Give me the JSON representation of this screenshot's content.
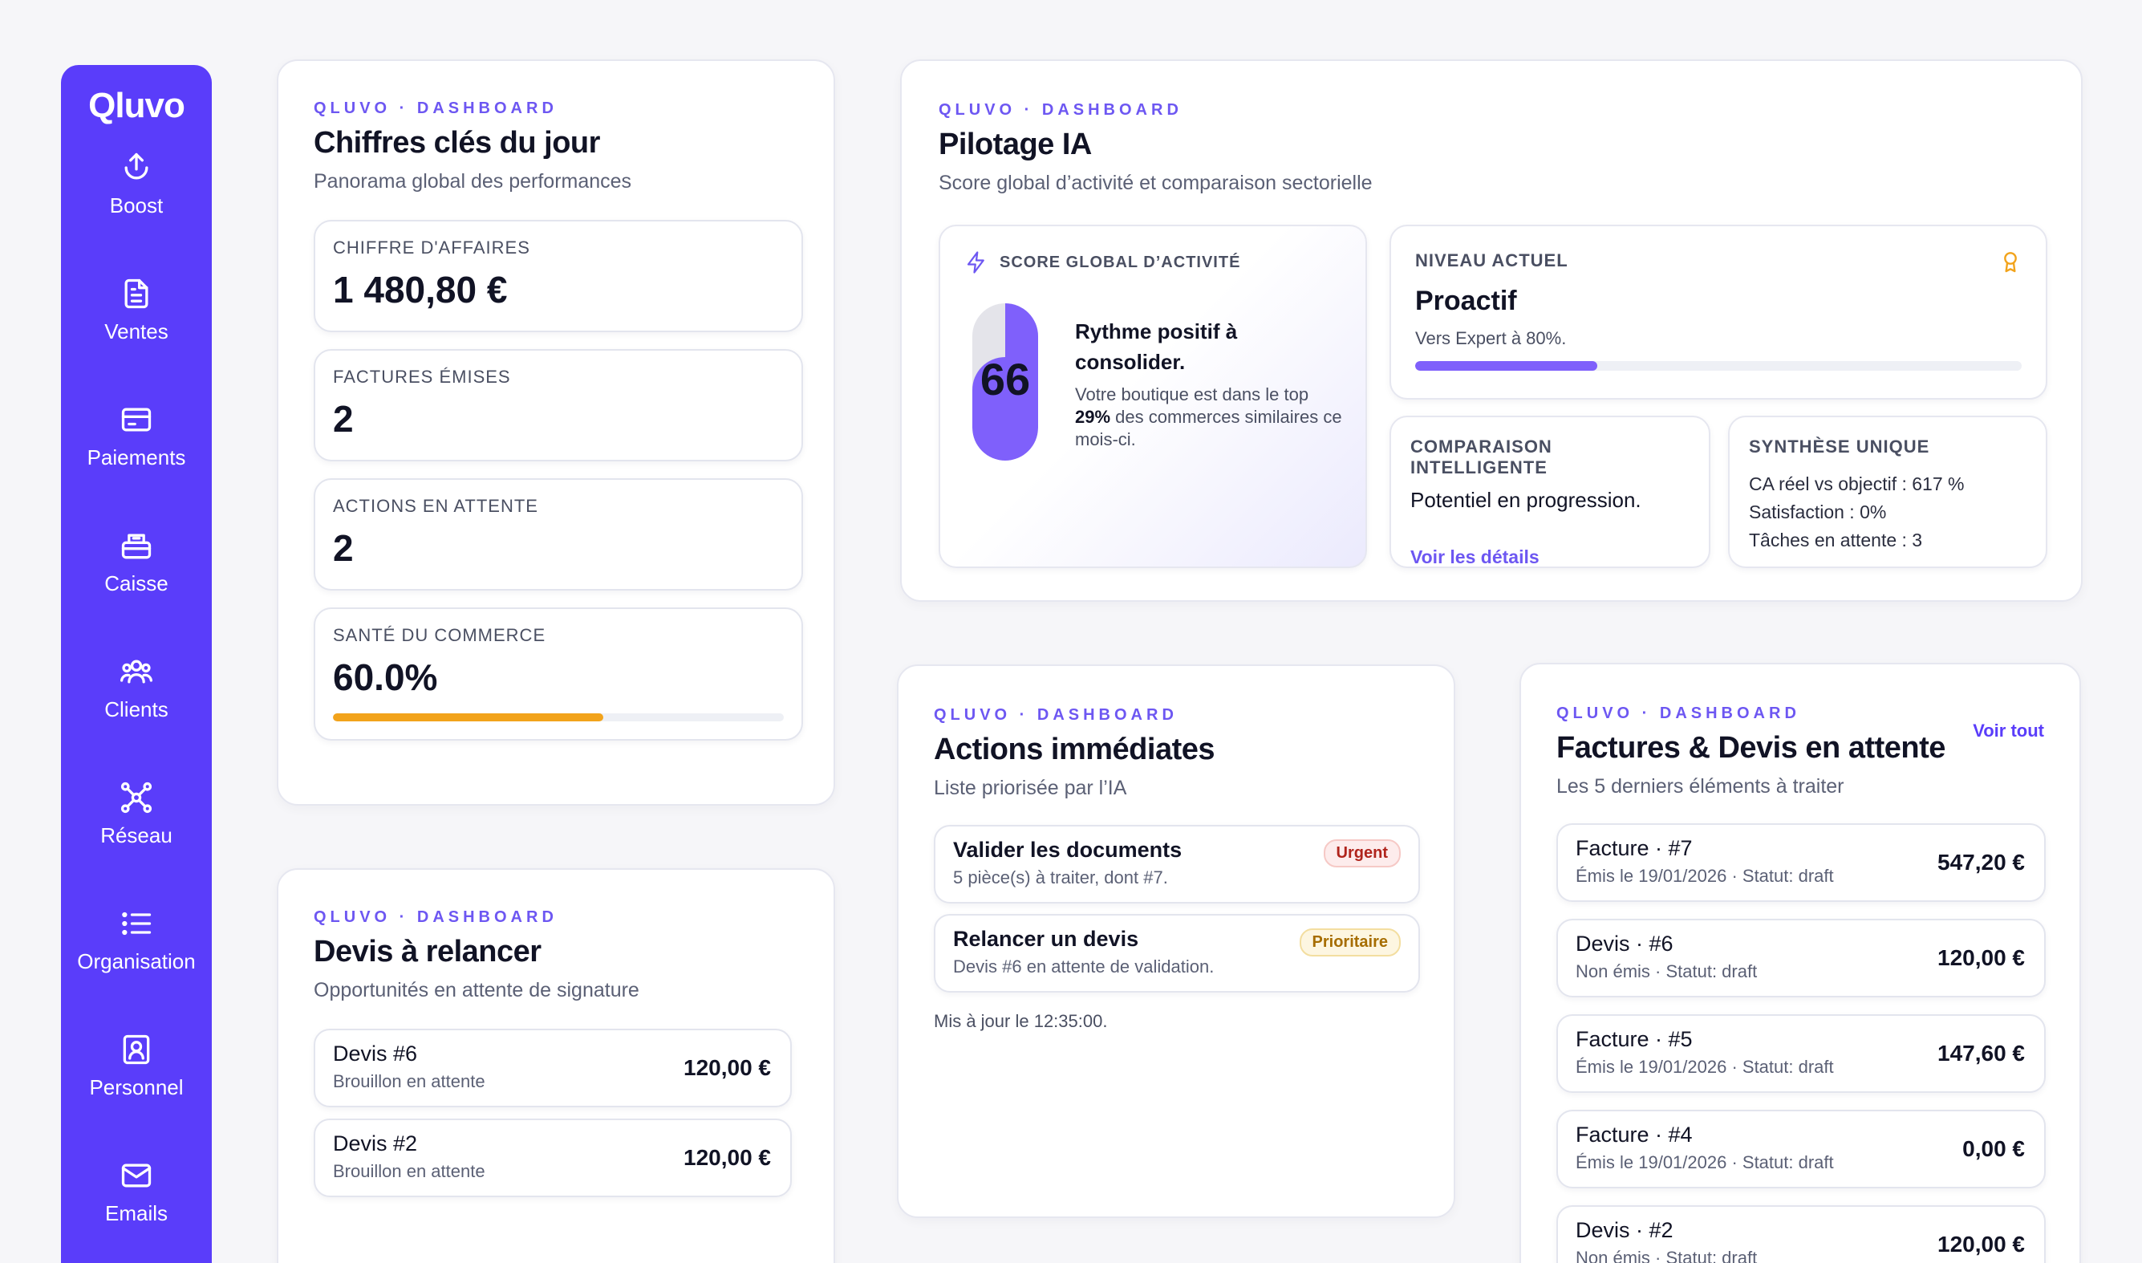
{
  "brand": {
    "logo": "Qluvo",
    "accent": "#5a3dfa"
  },
  "sidebar": {
    "items": [
      {
        "label": "Boost",
        "icon": "boost-icon"
      },
      {
        "label": "Ventes",
        "icon": "document-icon"
      },
      {
        "label": "Paiements",
        "icon": "credit-card-icon"
      },
      {
        "label": "Caisse",
        "icon": "register-icon"
      },
      {
        "label": "Clients",
        "icon": "users-icon"
      },
      {
        "label": "Réseau",
        "icon": "network-icon"
      },
      {
        "label": "Organisation",
        "icon": "list-icon"
      },
      {
        "label": "Personnel",
        "icon": "id-badge-icon"
      },
      {
        "label": "Emails",
        "icon": "mail-icon"
      }
    ]
  },
  "kpis": {
    "kicker": "QLUVO · DASHBOARD",
    "title": "Chiffres clés du jour",
    "subtitle": "Panorama global des performances",
    "items": [
      {
        "label": "CHIFFRE D'AFFAIRES",
        "value": "1 480,80 €"
      },
      {
        "label": "FACTURES ÉMISES",
        "value": "2"
      },
      {
        "label": "ACTIONS EN ATTENTE",
        "value": "2"
      },
      {
        "label": "SANTÉ DU COMMERCE",
        "value": "60.0%",
        "progress": 0.6,
        "color": "#f2a31b"
      }
    ]
  },
  "pilotage": {
    "kicker": "QLUVO · DASHBOARD",
    "title": "Pilotage IA",
    "subtitle": "Score global d’activité et comparaison sectorielle",
    "score": {
      "label": "SCORE GLOBAL D’ACTIVITÉ",
      "value": "66",
      "fill": 0.66,
      "headline": "Rythme positif à consolider.",
      "desc_pre": "Votre boutique est dans le top",
      "desc_bold": "29%",
      "desc_post": "des commerces similaires ce mois-ci."
    },
    "niveau": {
      "label": "NIVEAU ACTUEL",
      "value": "Proactif",
      "desc": "Vers Expert à 80%.",
      "progress": 0.3,
      "icon": "award-icon"
    },
    "comparaison": {
      "label": "COMPARAISON INTELLIGENTE",
      "text": "Potentiel en progression.",
      "link": "Voir les détails"
    },
    "synthese": {
      "label": "SYNTHÈSE UNIQUE",
      "lines": [
        "CA réel vs objectif : 617 %",
        "Satisfaction : 0%",
        "Tâches en attente : 3"
      ]
    }
  },
  "actions": {
    "kicker": "QLUVO · DASHBOARD",
    "title": "Actions immédiates",
    "subtitle": "Liste priorisée par l’IA",
    "items": [
      {
        "title": "Valider les documents",
        "desc": "5 pièce(s) à traiter, dont #7.",
        "badge": "Urgent"
      },
      {
        "title": "Relancer un devis",
        "desc": "Devis #6 en attente de validation.",
        "badge": "Prioritaire"
      }
    ],
    "updated": "Mis à jour le 12:35:00."
  },
  "factures": {
    "kicker": "QLUVO · DASHBOARD",
    "title": "Factures & Devis en attente",
    "subtitle": "Les 5 derniers éléments à traiter",
    "link": "Voir tout",
    "items": [
      {
        "title": "Facture · #7",
        "desc": "Émis le 19/01/2026 · Statut: draft",
        "amount": "547,20 €"
      },
      {
        "title": "Devis · #6",
        "desc": "Non émis · Statut: draft",
        "amount": "120,00 €"
      },
      {
        "title": "Facture · #5",
        "desc": "Émis le 19/01/2026 · Statut: draft",
        "amount": "147,60 €"
      },
      {
        "title": "Facture · #4",
        "desc": "Émis le 19/01/2026 · Statut: draft",
        "amount": "0,00 €"
      },
      {
        "title": "Devis · #2",
        "desc": "Non émis · Statut: draft",
        "amount": "120,00 €"
      }
    ]
  },
  "devis": {
    "kicker": "QLUVO · DASHBOARD",
    "title": "Devis à relancer",
    "subtitle": "Opportunités en attente de signature",
    "items": [
      {
        "title": "Devis #6",
        "desc": "Brouillon en attente",
        "amount": "120,00 €"
      },
      {
        "title": "Devis #2",
        "desc": "Brouillon en attente",
        "amount": "120,00 €"
      }
    ]
  }
}
